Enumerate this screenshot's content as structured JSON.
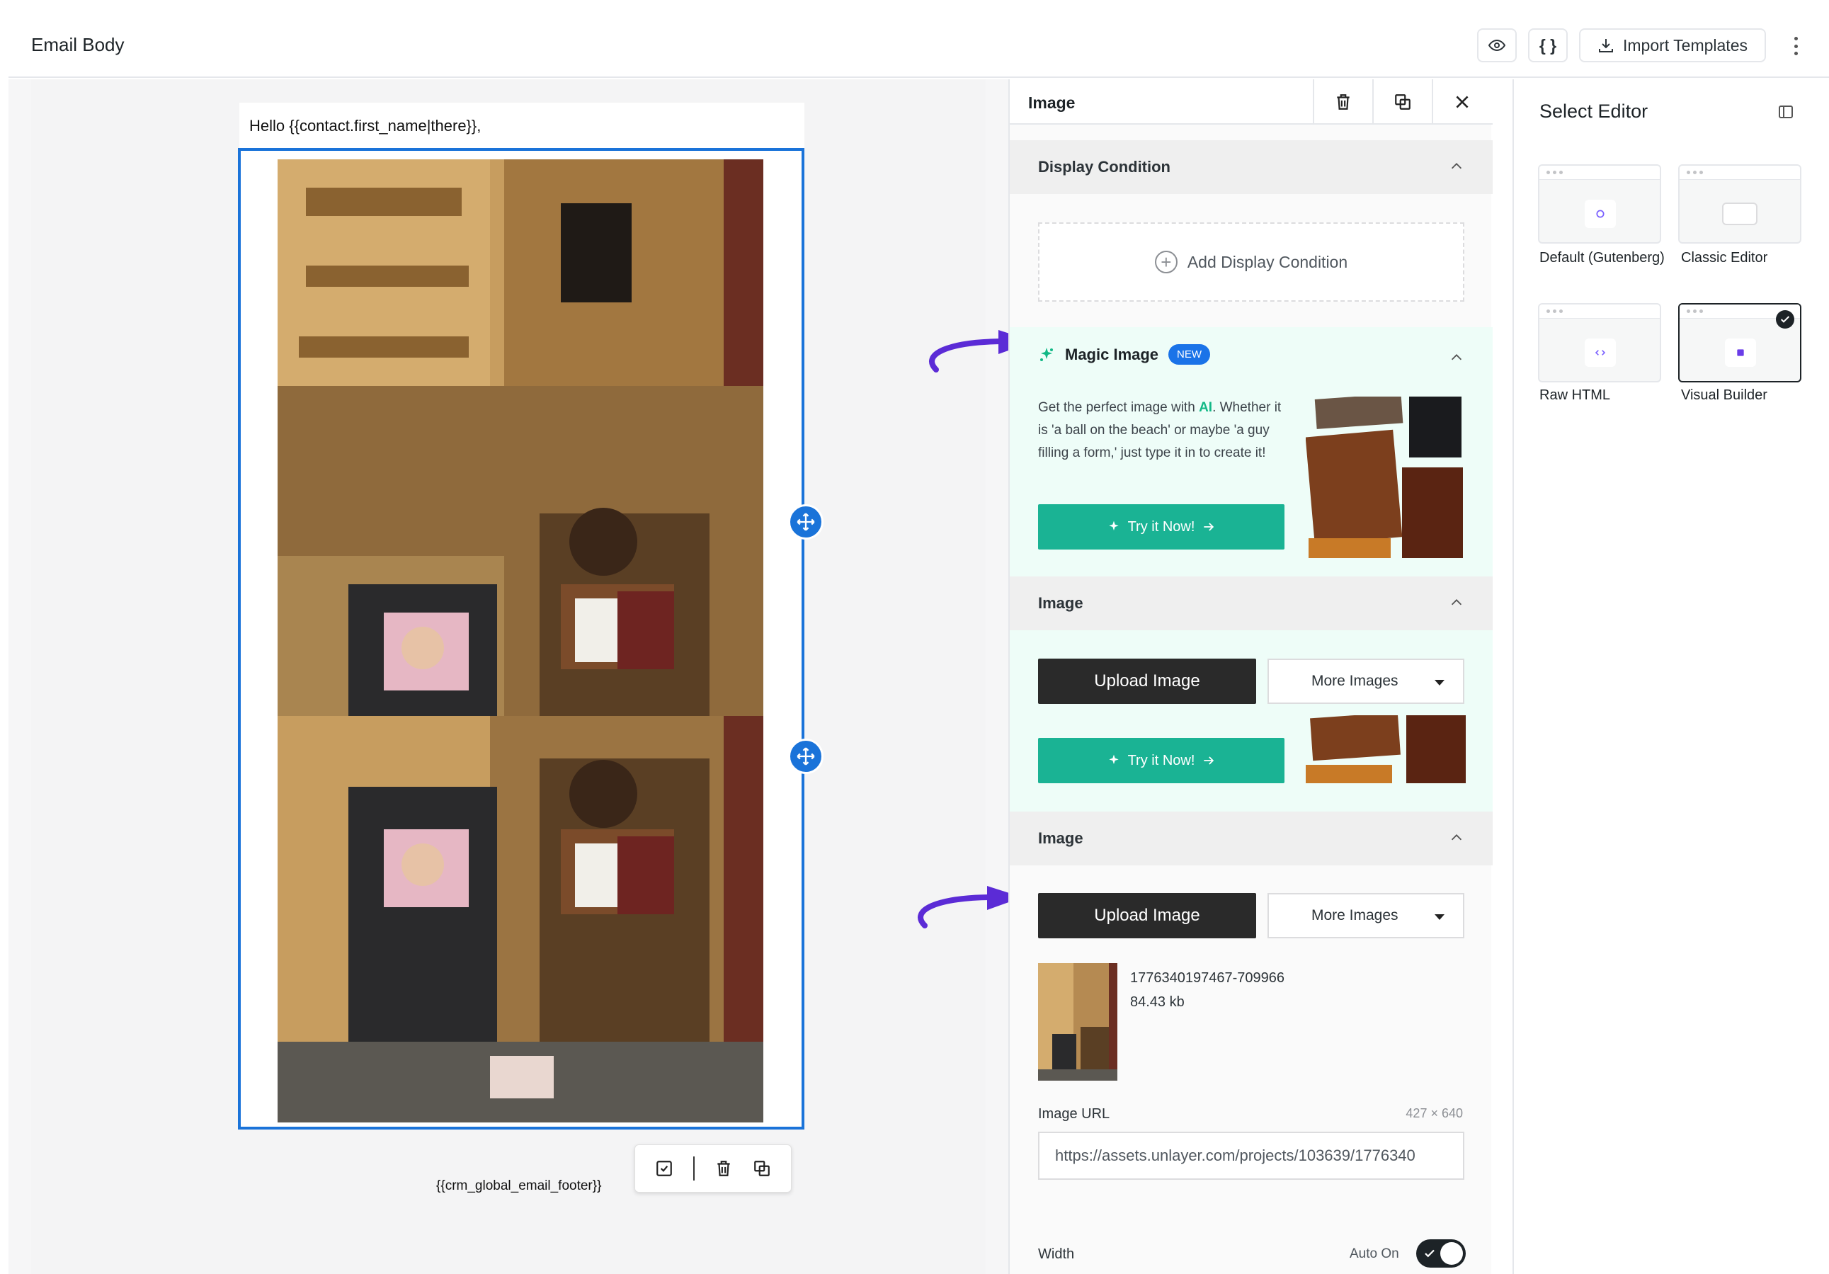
{
  "header": {
    "title": "Email Body",
    "preview_icon": "eye-icon",
    "code_icon": "code-braces-icon",
    "code_label": "{ }",
    "import_label": "Import Templates",
    "more_icon": "kebab-menu-icon"
  },
  "canvas": {
    "greeting": "Hello {{contact.first_name|there}},",
    "footer_tag": "{{crm_global_email_footer}}"
  },
  "panel": {
    "title": "Image",
    "display_condition": {
      "heading": "Display Condition",
      "add_label": "Add Display Condition"
    },
    "magic_image": {
      "title": "Magic Image",
      "badge": "NEW",
      "desc_before": "Get the perfect image with ",
      "desc_ai": "AI",
      "desc_after": ". Whether it is 'a ball on the beach' or maybe 'a guy filling a form,' just type it in to create it!",
      "try_label": "Try it Now!"
    },
    "image_section_1": {
      "heading": "Image",
      "upload_label": "Upload Image",
      "more_label": "More Images",
      "try_label": "Try it Now!"
    },
    "image_section_2": {
      "heading": "Image",
      "upload_label": "Upload Image",
      "more_label": "More Images",
      "file_name": "1776340197467-709966",
      "file_size": "84.43 kb",
      "url_label": "Image URL",
      "dimensions": "427 × 640",
      "url_value": "https://assets.unlayer.com/projects/103639/1776340",
      "width_label": "Width",
      "auto_label": "Auto On"
    }
  },
  "editor_select": {
    "title": "Select Editor",
    "options": [
      {
        "label": "Default (Gutenberg)",
        "selected": false
      },
      {
        "label": "Classic Editor",
        "selected": false
      },
      {
        "label": "Raw HTML",
        "selected": false
      },
      {
        "label": "Visual Builder",
        "selected": true
      }
    ]
  },
  "colors": {
    "accent_blue": "#1a73d9",
    "teal": "#1ab394",
    "arrow_purple": "#5b2bd6",
    "dark": "#2a2a2a"
  }
}
